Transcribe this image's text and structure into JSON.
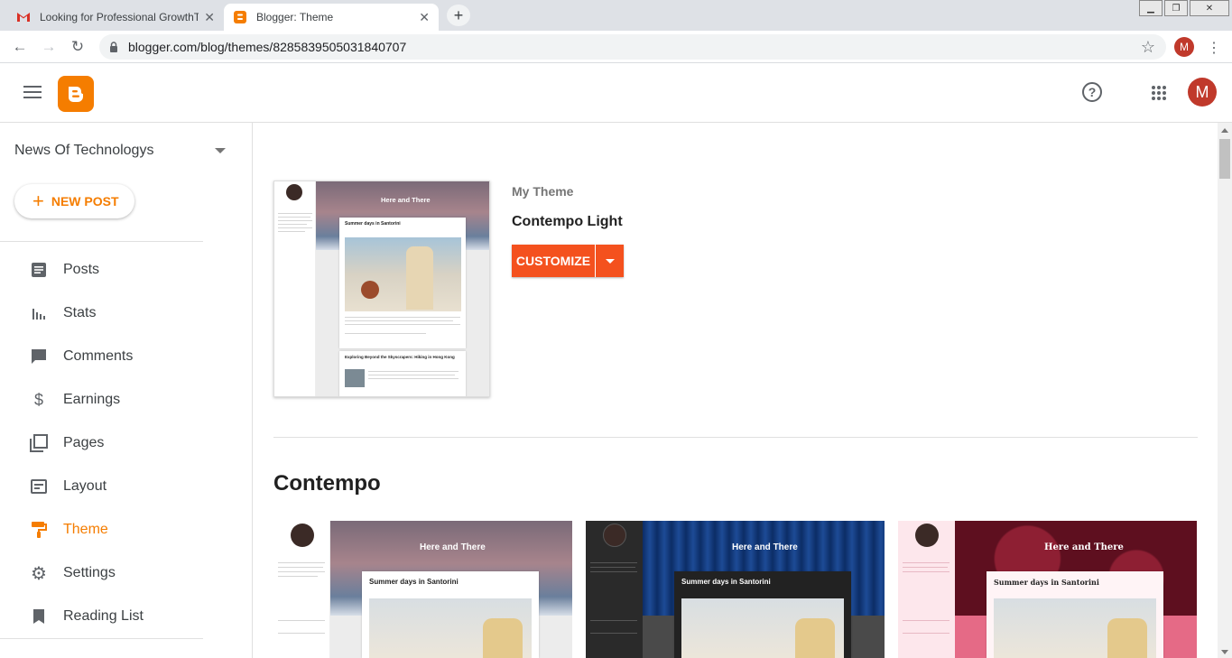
{
  "browser": {
    "tabs": [
      {
        "title": "Looking for Professional GrowthT",
        "favicon": "gmail-icon",
        "active": false
      },
      {
        "title": "Blogger: Theme",
        "favicon": "blogger-icon",
        "active": true
      }
    ],
    "url": "blogger.com/blog/themes/8285839505031840707",
    "account_initial": "M"
  },
  "header": {
    "account_initial": "M",
    "help_glyph": "?"
  },
  "sidebar": {
    "blog_name": "News Of Technologys",
    "new_post_label": "NEW POST",
    "items": [
      {
        "label": "Posts",
        "icon": "posts-icon"
      },
      {
        "label": "Stats",
        "icon": "stats-icon"
      },
      {
        "label": "Comments",
        "icon": "comments-icon"
      },
      {
        "label": "Earnings",
        "icon": "dollar-icon"
      },
      {
        "label": "Pages",
        "icon": "pages-icon"
      },
      {
        "label": "Layout",
        "icon": "layout-icon"
      },
      {
        "label": "Theme",
        "icon": "paint-roller-icon",
        "active": true
      },
      {
        "label": "Settings",
        "icon": "gear-icon"
      },
      {
        "label": "Reading List",
        "icon": "bookmark-icon"
      }
    ]
  },
  "main": {
    "my_theme_label": "My Theme",
    "current_theme_name": "Contempo Light",
    "customize_label": "CUSTOMIZE",
    "section_title": "Contempo",
    "preview": {
      "blog_title": "Here and There",
      "post_title": "Summer days in Santorini",
      "second_post_title": "Exploring Beyond the Skyscrapers: Hiking in Hong Kong"
    }
  },
  "colors": {
    "accent": "#f57d00",
    "customize": "#f4511e",
    "avatar": "#c0392b"
  }
}
